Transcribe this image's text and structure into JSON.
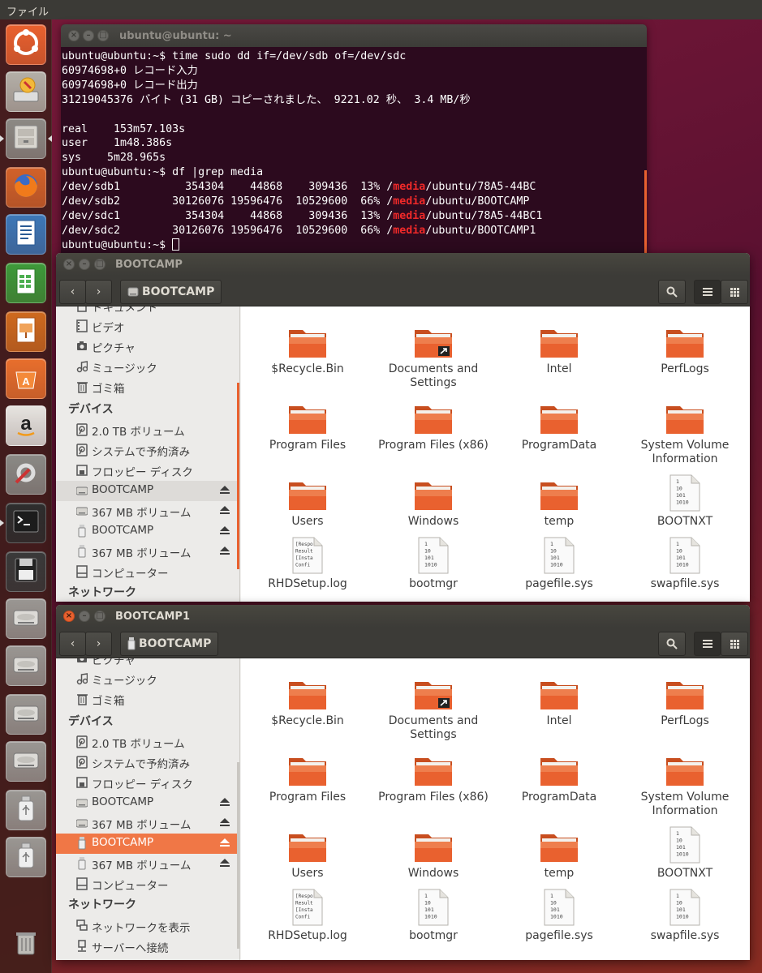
{
  "top_panel": {
    "menu_label": "ファイル"
  },
  "launcher": {
    "items": [
      {
        "name": "ubuntu-dash-icon"
      },
      {
        "name": "system-installer-icon"
      },
      {
        "name": "files-icon"
      },
      {
        "name": "firefox-icon"
      },
      {
        "name": "libreoffice-writer-icon"
      },
      {
        "name": "libreoffice-calc-icon"
      },
      {
        "name": "libreoffice-impress-icon"
      },
      {
        "name": "software-center-icon"
      },
      {
        "name": "amazon-icon"
      },
      {
        "name": "system-settings-icon"
      },
      {
        "name": "terminal-icon"
      },
      {
        "name": "floppy-icon"
      },
      {
        "name": "drive-icon"
      },
      {
        "name": "drive-icon"
      },
      {
        "name": "drive-icon"
      },
      {
        "name": "drive-icon"
      },
      {
        "name": "usb-drive-icon"
      },
      {
        "name": "usb-drive-icon"
      },
      {
        "name": "trash-icon"
      }
    ]
  },
  "terminal": {
    "title": "ubuntu@ubuntu: ~",
    "lines": [
      "ubuntu@ubuntu:~$ time sudo dd if=/dev/sdb of=/dev/sdc",
      "60974698+0 レコード入力",
      "60974698+0 レコード出力",
      "31219045376 バイト (31 GB) コピーされました、 9221.02 秒、 3.4 MB/秒",
      "",
      "real\t153m57.103s",
      "user\t1m48.386s",
      "sys\t5m28.965s",
      "ubuntu@ubuntu:~$ df |grep media"
    ],
    "df_rows": [
      {
        "pre": "/dev/sdb1          354304    44868    309436  13% /",
        "hl": "media",
        "post": "/ubuntu/78A5-44BC"
      },
      {
        "pre": "/dev/sdb2        30126076 19596476  10529600  66% /",
        "hl": "media",
        "post": "/ubuntu/BOOTCAMP"
      },
      {
        "pre": "/dev/sdc1          354304    44868    309436  13% /",
        "hl": "media",
        "post": "/ubuntu/78A5-44BC1"
      },
      {
        "pre": "/dev/sdc2        30126076 19596476  10529600  66% /",
        "hl": "media",
        "post": "/ubuntu/BOOTCAMP1"
      }
    ],
    "prompt": "ubuntu@ubuntu:~$ "
  },
  "windows": [
    {
      "title": "BOOTCAMP",
      "location": "BOOTCAMP",
      "sidebar": {
        "places": [
          "ドキュメント",
          "ビデオ",
          "ピクチャ",
          "ミュージック",
          "ゴミ箱"
        ],
        "devices_header": "デバイス",
        "devices": [
          "2.0 TB ボリューム",
          "システムで予約済み",
          "フロッピー ディスク",
          "BOOTCAMP",
          "367 MB ボリューム",
          "BOOTCAMP",
          "367 MB ボリューム",
          "コンピューター"
        ],
        "network_header": "ネットワーク"
      },
      "files": [
        {
          "name": "$Recycle.Bin",
          "type": "folder"
        },
        {
          "name": "Documents and Settings",
          "type": "folder-link"
        },
        {
          "name": "Intel",
          "type": "folder"
        },
        {
          "name": "PerfLogs",
          "type": "folder"
        },
        {
          "name": "Program Files",
          "type": "folder"
        },
        {
          "name": "Program Files (x86)",
          "type": "folder"
        },
        {
          "name": "ProgramData",
          "type": "folder"
        },
        {
          "name": "System Volume Information",
          "type": "folder"
        },
        {
          "name": "Users",
          "type": "folder"
        },
        {
          "name": "Windows",
          "type": "folder"
        },
        {
          "name": "temp",
          "type": "folder"
        },
        {
          "name": "BOOTNXT",
          "type": "binary"
        },
        {
          "name": "RHDSetup.log",
          "type": "text"
        },
        {
          "name": "bootmgr",
          "type": "binary"
        },
        {
          "name": "pagefile.sys",
          "type": "binary"
        },
        {
          "name": "swapfile.sys",
          "type": "binary"
        }
      ]
    },
    {
      "title": "BOOTCAMP1",
      "location": "BOOTCAMP",
      "sidebar": {
        "places": [
          "ピクチャ",
          "ミュージック",
          "ゴミ箱"
        ],
        "devices_header": "デバイス",
        "devices": [
          "2.0 TB ボリューム",
          "システムで予約済み",
          "フロッピー ディスク",
          "BOOTCAMP",
          "367 MB ボリューム",
          "BOOTCAMP",
          "367 MB ボリューム",
          "コンピューター"
        ],
        "network_header": "ネットワーク",
        "network": [
          "ネットワークを表示",
          "サーバーへ接続"
        ]
      },
      "files": [
        {
          "name": "$Recycle.Bin",
          "type": "folder"
        },
        {
          "name": "Documents and Settings",
          "type": "folder-link"
        },
        {
          "name": "Intel",
          "type": "folder"
        },
        {
          "name": "PerfLogs",
          "type": "folder"
        },
        {
          "name": "Program Files",
          "type": "folder"
        },
        {
          "name": "Program Files (x86)",
          "type": "folder"
        },
        {
          "name": "ProgramData",
          "type": "folder"
        },
        {
          "name": "System Volume Information",
          "type": "folder"
        },
        {
          "name": "Users",
          "type": "folder"
        },
        {
          "name": "Windows",
          "type": "folder"
        },
        {
          "name": "temp",
          "type": "folder"
        },
        {
          "name": "BOOTNXT",
          "type": "binary"
        },
        {
          "name": "RHDSetup.log",
          "type": "text"
        },
        {
          "name": "bootmgr",
          "type": "binary"
        },
        {
          "name": "pagefile.sys",
          "type": "binary"
        },
        {
          "name": "swapfile.sys",
          "type": "binary"
        }
      ]
    }
  ],
  "icons": {
    "binary_preview": "1\n10\n101\n1010",
    "text_preview": "[Respo\nResult\n[Insta\nConfi"
  },
  "colors": {
    "accent": "#f07746",
    "folder": "#e9612f",
    "terminal_bg": "#2c0a1e",
    "highlight": "#ef2929"
  }
}
